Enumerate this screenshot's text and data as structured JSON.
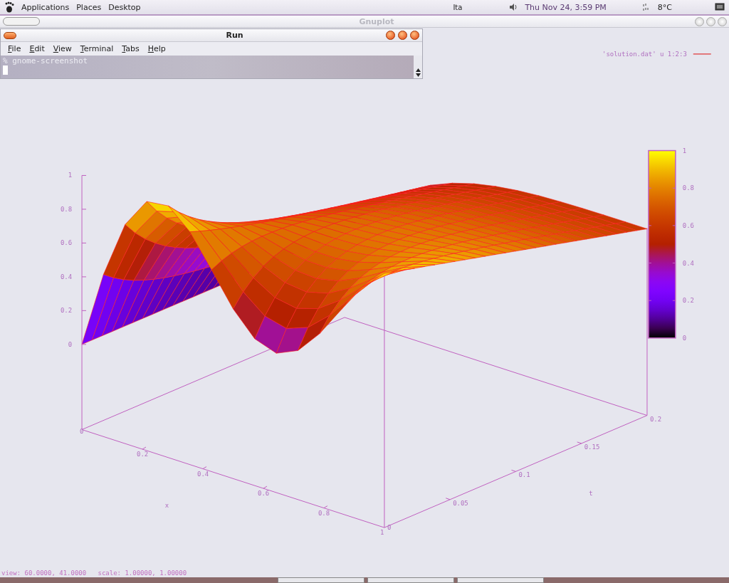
{
  "top_panel": {
    "menus": [
      "Applications",
      "Places",
      "Desktop"
    ],
    "keyboard_layout": "Ita",
    "clock": "Thu Nov 24, 3:59 PM",
    "temperature": "8°C"
  },
  "gnuplot_window": {
    "title": "Gnuplot",
    "active": false,
    "plot": {
      "legend": "'solution.dat' u 1:2:3",
      "z_ticks": [
        "1",
        "0.8",
        "0.6",
        "0.4",
        "0.2",
        "0"
      ],
      "x_ticks": [
        "0",
        "0.2",
        "0.4",
        "0.6",
        "0.8",
        "1"
      ],
      "x_label": "x",
      "t_ticks": [
        "0",
        "0.05",
        "0.1",
        "0.15",
        "0.2"
      ],
      "t_label": "t",
      "colorbar_ticks": [
        "1",
        "0.8",
        "0.6",
        "0.4",
        "0.2",
        "0"
      ]
    },
    "status": "view: 60.0000, 41.0000   scale: 1.00000, 1.00000"
  },
  "run_window": {
    "title": "Run",
    "active": true,
    "menus": [
      "File",
      "Edit",
      "View",
      "Terminal",
      "Tabs",
      "Help"
    ],
    "terminal_lines": [
      "% gnome-screenshot"
    ]
  }
}
